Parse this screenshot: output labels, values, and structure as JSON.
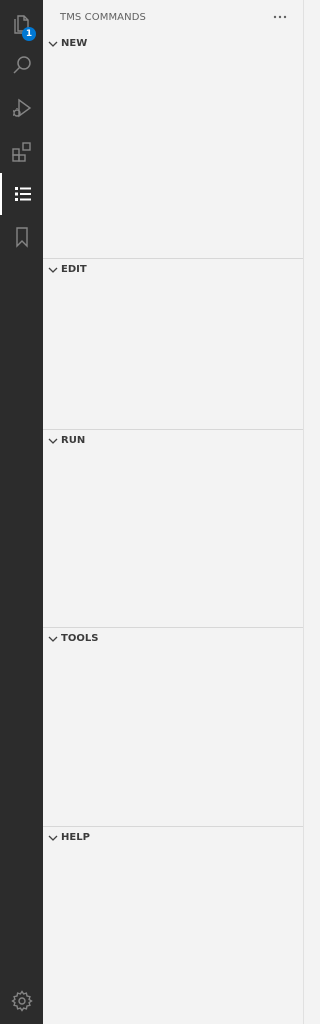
{
  "activity_bar": {
    "items": [
      {
        "name": "explorer",
        "icon": "files-icon",
        "badge": "1"
      },
      {
        "name": "search",
        "icon": "search-icon"
      },
      {
        "name": "run-debug",
        "icon": "run-debug-icon"
      },
      {
        "name": "extensions",
        "icon": "extensions-icon"
      },
      {
        "name": "tms-commands",
        "icon": "list-icon",
        "active": true
      },
      {
        "name": "bookmarks",
        "icon": "bookmark-icon"
      }
    ],
    "settings_icon": "gear-icon",
    "colors": {
      "background": "#2c2c2c",
      "icon": "#858585",
      "active_icon": "#ffffff",
      "badge": "#0078d4"
    }
  },
  "sidebar": {
    "title": "TMS COMMANDS",
    "more_actions_icon": "ellipsis-icon",
    "sections": [
      {
        "label": "NEW",
        "expanded": true
      },
      {
        "label": "EDIT",
        "expanded": true
      },
      {
        "label": "RUN",
        "expanded": true
      },
      {
        "label": "TOOLS",
        "expanded": true
      },
      {
        "label": "HELP",
        "expanded": true
      }
    ]
  }
}
